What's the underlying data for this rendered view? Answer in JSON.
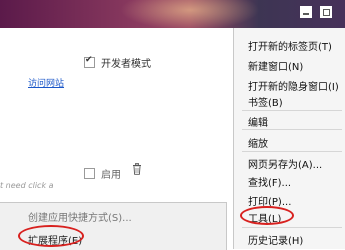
{
  "page": {
    "developer_mode_label": "开发者模式",
    "visit_site_link": "访问网站",
    "enable_label": "启用",
    "faded_text": "t need click a"
  },
  "submenu": {
    "items": [
      {
        "label": "创建应用快捷方式(S)..."
      },
      {
        "label": "扩展程序(E)"
      }
    ]
  },
  "menu": {
    "items": [
      {
        "label": "打开新的标签页(T)"
      },
      {
        "label": "新建窗口(N)"
      },
      {
        "label": "打开新的隐身窗口(I)"
      },
      {
        "label": "书签(B)"
      },
      {
        "label": "编辑"
      },
      {
        "label": "缩放"
      },
      {
        "label": "网页另存为(A)..."
      },
      {
        "label": "查找(F)..."
      },
      {
        "label": "打印(P)..."
      },
      {
        "label": "工具(L)"
      },
      {
        "label": "历史记录(H)"
      }
    ]
  },
  "colors": {
    "highlight": "#d8211f",
    "link": "#1a56c8"
  },
  "icons": [
    "minimize-icon",
    "maximize-icon",
    "trash-icon",
    "checkmark-icon"
  ]
}
